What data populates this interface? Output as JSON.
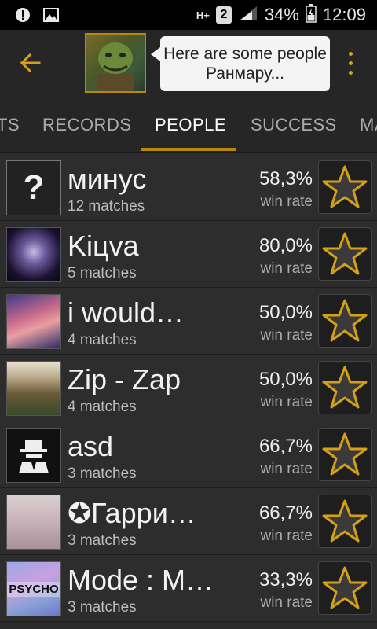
{
  "status_bar": {
    "network": "H+",
    "sim": "2",
    "battery": "34%",
    "time": "12:09"
  },
  "header": {
    "bubble_text": "Here are some people Ранмару..."
  },
  "tabs": [
    {
      "label": "TS",
      "active": false
    },
    {
      "label": "RECORDS",
      "active": false
    },
    {
      "label": "PEOPLE",
      "active": true
    },
    {
      "label": "SUCCESS",
      "active": false
    },
    {
      "label": "MA",
      "active": false
    }
  ],
  "people": [
    {
      "name": "минус",
      "matches": "12 matches",
      "win_rate": "58,3%",
      "win_rate_label": "win rate",
      "avatar": "unknown",
      "avatar_text": "?"
    },
    {
      "name": "Kiцva",
      "matches": "5 matches",
      "win_rate": "80,0%",
      "win_rate_label": "win rate",
      "avatar": "anime-girl-purple"
    },
    {
      "name": "i would…",
      "matches": "4 matches",
      "win_rate": "50,0%",
      "win_rate_label": "win rate",
      "avatar": "anime-girl-pink"
    },
    {
      "name": "Zip - Zap",
      "matches": "4 matches",
      "win_rate": "50,0%",
      "win_rate_label": "win rate",
      "avatar": "girl-cap"
    },
    {
      "name": "asd",
      "matches": "3 matches",
      "win_rate": "66,7%",
      "win_rate_label": "win rate",
      "avatar": "hat-man-icon"
    },
    {
      "name": "✪Гарри…",
      "matches": "3 matches",
      "win_rate": "66,7%",
      "win_rate_label": "win rate",
      "avatar": "sketch-boy"
    },
    {
      "name": "Mode : M…",
      "matches": "3 matches",
      "win_rate": "33,3%",
      "win_rate_label": "win rate",
      "avatar": "psycho-art",
      "avatar_text": "PSYCHO"
    }
  ],
  "colors": {
    "accent": "#b8860b",
    "background": "#2b2b2b",
    "star_gold": "#d4a017"
  }
}
